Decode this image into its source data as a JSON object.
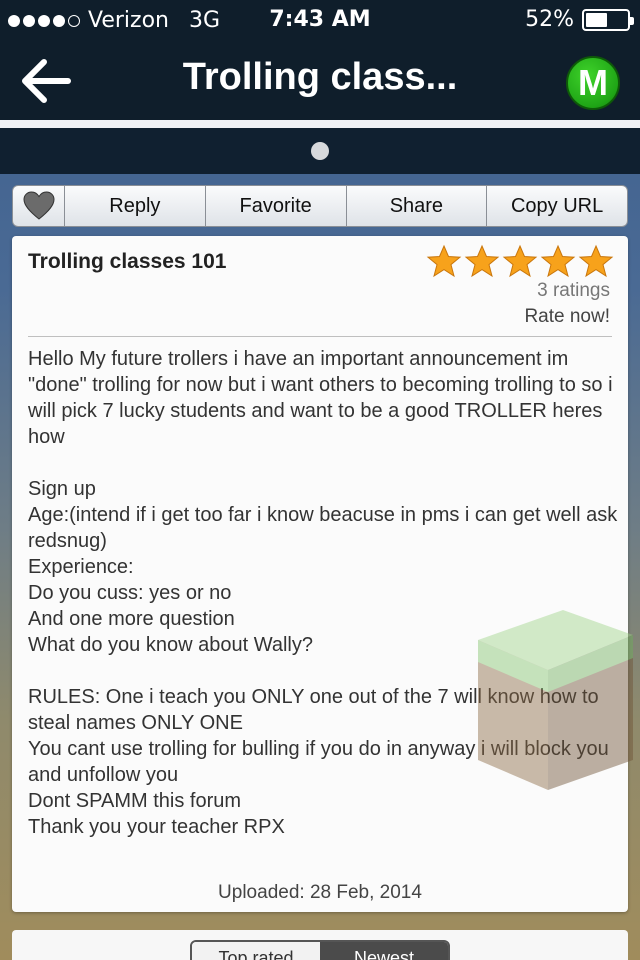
{
  "status_bar": {
    "carrier": "Verizon",
    "network": "3G",
    "time": "7:43 AM",
    "battery": "52%",
    "battery_level": 0.52
  },
  "nav": {
    "title": "Trolling class...",
    "badge_letter": "M",
    "badge_color": "#1fa516"
  },
  "actions": {
    "heart_icon": "heart-icon",
    "reply": "Reply",
    "favorite": "Favorite",
    "share": "Share",
    "copy_url": "Copy URL"
  },
  "post": {
    "title": "Trolling classes 101",
    "stars": 5,
    "ratings": "3 ratings",
    "rate_now": "Rate now!",
    "body": "Hello My future trollers i have an important announcement im \"done\" trolling for now but i want others to becoming trolling to so i will pick 7 lucky students  and want to be a good TROLLER heres how\n\nSign up\nAge:(intend if i get too far i know beacuse in pms i can get well ask redsnug)\nExperience:\nDo you cuss: yes or no\nAnd one more question\nWhat do you know about Wally?\n\nRULES: One i teach you ONLY one out of the 7 will know how to steal names ONLY ONE\nYou cant use trolling for bulling if you do in anyway i will block you and unfollow you\nDont SPAMM this forum\nThank you your teacher RPX",
    "uploaded": "Uploaded: 28 Feb, 2014"
  },
  "sort": {
    "top_rated": "Top rated",
    "newest": "Newest"
  },
  "colors": {
    "nav_bg": "#0f1e2b",
    "star": "#f7a21b"
  }
}
